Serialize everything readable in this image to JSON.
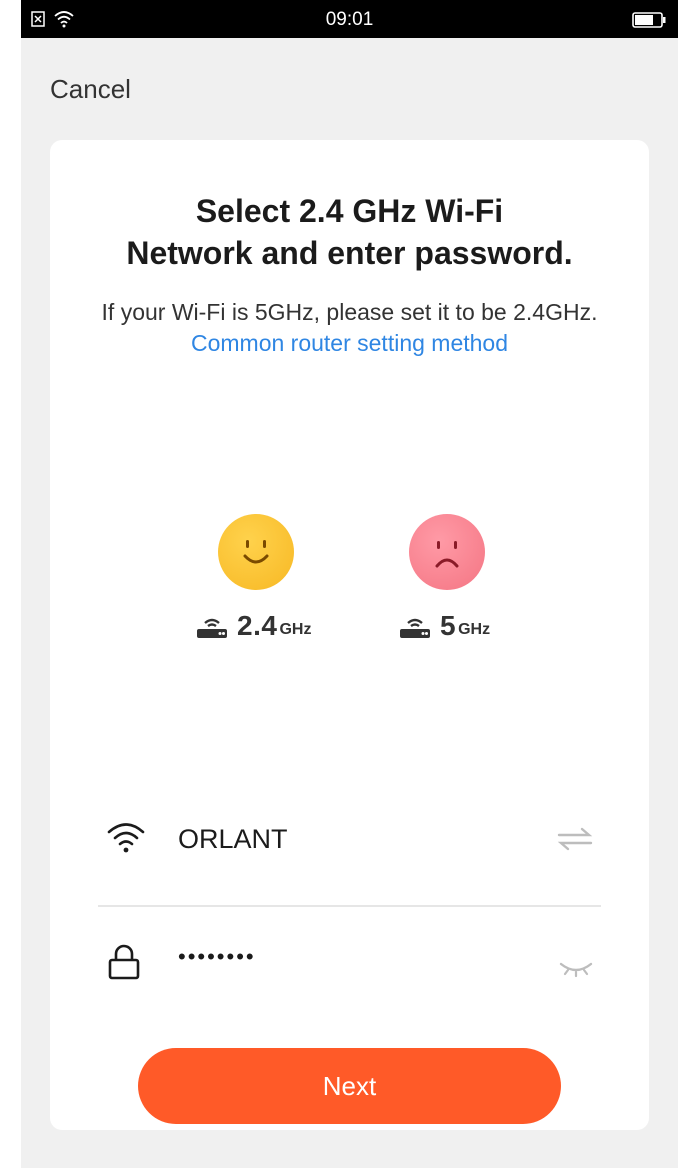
{
  "status_bar": {
    "time": "09:01"
  },
  "header": {
    "cancel_label": "Cancel"
  },
  "card": {
    "title_line1": "Select 2.4 GHz Wi-Fi",
    "title_line2": "Network and enter password.",
    "subtitle_text": "If your Wi-Fi is 5GHz, please set it to be 2.4GHz.",
    "subtitle_link": "Common router setting method"
  },
  "bands": [
    {
      "num": "2.4",
      "unit": "GHz",
      "face": "happy"
    },
    {
      "num": "5",
      "unit": "GHz",
      "face": "sad"
    }
  ],
  "form": {
    "ssid_value": "ORLANT",
    "password_value": "••••••••",
    "ssid_icon": "wifi-icon",
    "password_icon": "lock-icon",
    "switch_icon": "switch-arrows-icon",
    "visibility_icon": "eye-closed-icon"
  },
  "actions": {
    "next_label": "Next"
  },
  "colors": {
    "accent": "#ff5a28",
    "link": "#2f86e3",
    "good": "#f7b824",
    "bad": "#f47583"
  }
}
